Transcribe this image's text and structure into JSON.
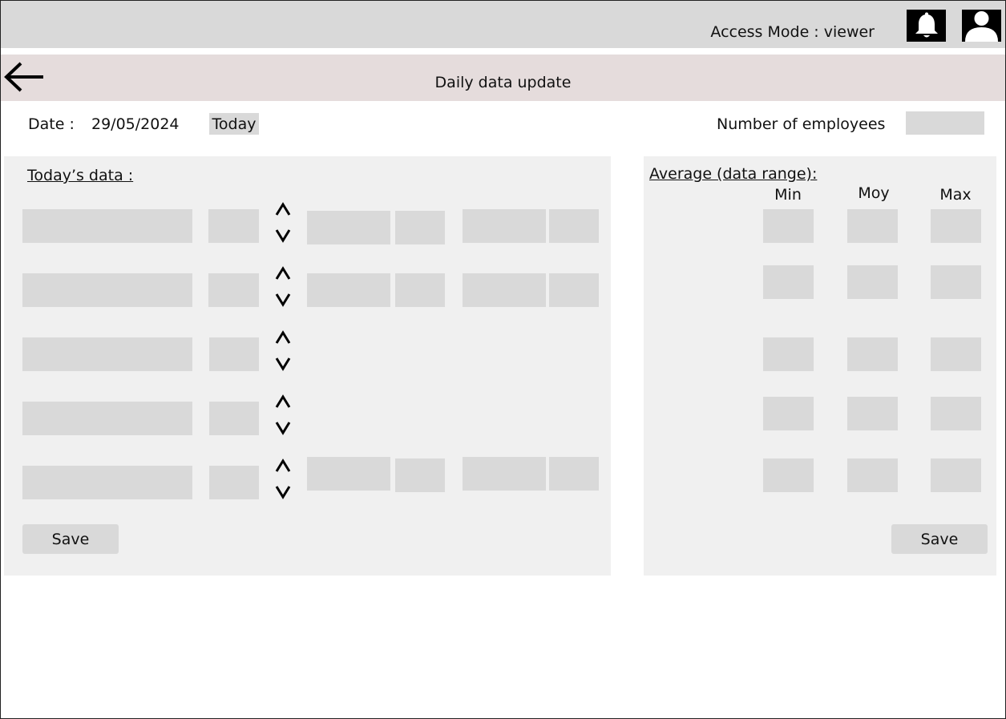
{
  "header": {
    "access_mode": "Access Mode : viewer",
    "icons": [
      "bell-icon",
      "user-icon"
    ]
  },
  "subheader": {
    "title": "Daily data update",
    "back_icon": "arrow-left-icon"
  },
  "date_row": {
    "date_label": "Date :",
    "date_value": "29/05/2024",
    "today_button": "Today",
    "employees_label": "Number of employees"
  },
  "today_panel": {
    "title": "Today’s data :",
    "save_label": "Save"
  },
  "average_panel": {
    "title": "Average (data range):",
    "columns": [
      "Min",
      "Moy",
      "Max"
    ],
    "save_label": "Save"
  }
}
